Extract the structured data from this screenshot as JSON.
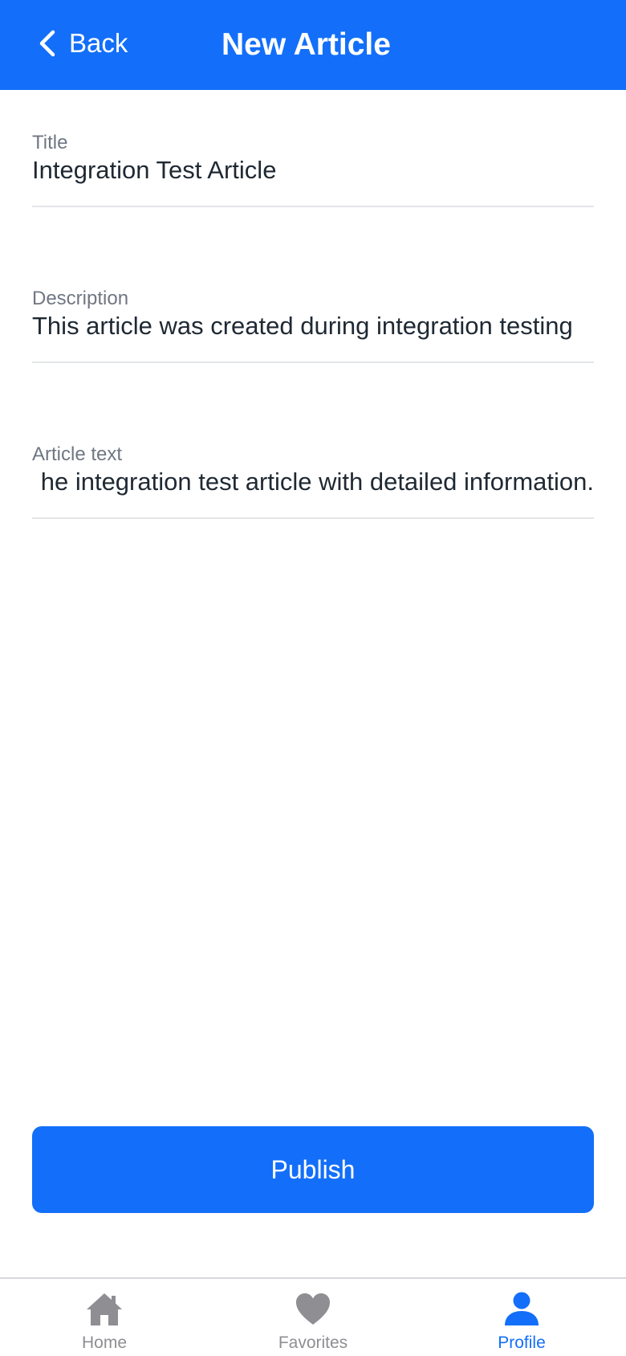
{
  "header": {
    "back_label": "Back",
    "title": "New Article"
  },
  "form": {
    "title": {
      "label": "Title",
      "value": "Integration Test Article"
    },
    "description": {
      "label": "Description",
      "value": "This article was created during integration testing"
    },
    "body": {
      "label": "Article text",
      "value": "he integration test article with detailed information."
    }
  },
  "publish_label": "Publish",
  "tabs": [
    {
      "label": "Home",
      "icon": "home-icon",
      "active": false
    },
    {
      "label": "Favorites",
      "icon": "heart-icon",
      "active": false
    },
    {
      "label": "Profile",
      "icon": "person-icon",
      "active": true
    }
  ],
  "colors": {
    "primary": "#136ff9",
    "tab_inactive": "#8e8e93",
    "tab_active": "#136ff9",
    "field_label": "#6f7782",
    "field_text": "#1f2933"
  }
}
